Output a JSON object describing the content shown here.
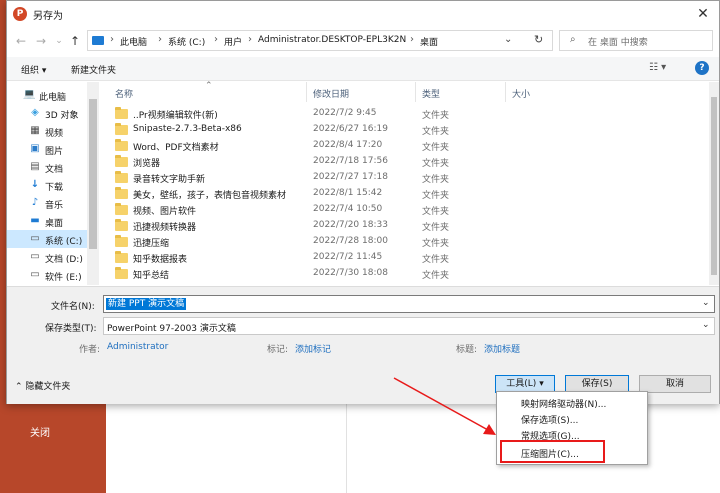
{
  "background_app": {
    "close_label": "关闭",
    "accent": "#b7472a"
  },
  "dialog": {
    "title": "另存为",
    "app_icon": "P",
    "close_glyph": "✕"
  },
  "address_bar": {
    "crumbs": [
      "此电脑",
      "系统 (C:)",
      "用户",
      "Administrator.DESKTOP-EPL3K2N",
      "桌面"
    ],
    "search_placeholder": "在 桌面 中搜索"
  },
  "toolbar": {
    "organize": "组织 ▾",
    "new_folder": "新建文件夹"
  },
  "nav_pane": {
    "items": [
      {
        "label": "此电脑",
        "icon": "computer-icon",
        "glyph": "💻"
      },
      {
        "label": "3D 对象",
        "icon": "cube-icon",
        "glyph": "◈"
      },
      {
        "label": "视频",
        "icon": "video-icon",
        "glyph": "▦"
      },
      {
        "label": "图片",
        "icon": "image-icon",
        "glyph": "▣"
      },
      {
        "label": "文档",
        "icon": "document-icon",
        "glyph": "▤"
      },
      {
        "label": "下载",
        "icon": "download-icon",
        "glyph": "↓"
      },
      {
        "label": "音乐",
        "icon": "music-icon",
        "glyph": "♪"
      },
      {
        "label": "桌面",
        "icon": "desktop-icon",
        "glyph": "▬"
      },
      {
        "label": "系统 (C:)",
        "icon": "drive-icon",
        "glyph": "▭"
      },
      {
        "label": "文档 (D:)",
        "icon": "drive-icon",
        "glyph": "▭"
      },
      {
        "label": "软件 (E:)",
        "icon": "drive-icon",
        "glyph": "▭"
      }
    ]
  },
  "file_list": {
    "columns": [
      "名称",
      "修改日期",
      "类型",
      "大小"
    ],
    "rows": [
      {
        "name": "..Pr视频编辑软件(新)",
        "date": "2022/7/2 9:45",
        "type": "文件夹"
      },
      {
        "name": "Snipaste-2.7.3-Beta-x86",
        "date": "2022/6/27 16:19",
        "type": "文件夹"
      },
      {
        "name": "Word、PDF文档素材",
        "date": "2022/8/4 17:20",
        "type": "文件夹"
      },
      {
        "name": "浏览器",
        "date": "2022/7/18 17:56",
        "type": "文件夹"
      },
      {
        "name": "录音转文字助手新",
        "date": "2022/7/27 17:18",
        "type": "文件夹"
      },
      {
        "name": "美女，壁纸，孩子，表情包音视频素材",
        "date": "2022/8/1 15:42",
        "type": "文件夹"
      },
      {
        "name": "视频、图片软件",
        "date": "2022/7/4 10:50",
        "type": "文件夹"
      },
      {
        "name": "迅捷视频转换器",
        "date": "2022/7/20 18:33",
        "type": "文件夹"
      },
      {
        "name": "迅捷压缩",
        "date": "2022/7/28 18:00",
        "type": "文件夹"
      },
      {
        "name": "知乎数据报表",
        "date": "2022/7/2 11:45",
        "type": "文件夹"
      },
      {
        "name": "知乎总结",
        "date": "2022/7/30 18:08",
        "type": "文件夹"
      }
    ]
  },
  "form": {
    "filename_label": "文件名(N):",
    "filename_value": "新建 PPT 演示文稿",
    "filetype_label": "保存类型(T):",
    "filetype_value": "PowerPoint 97-2003 演示文稿",
    "author_label": "作者:",
    "author_value": "Administrator",
    "tags_label": "标记:",
    "tags_value": "添加标记",
    "title_label": "标题:",
    "title_value": "添加标题"
  },
  "footer": {
    "hide_folders": "隐藏文件夹",
    "tools": "工具(L)",
    "save": "保存(S)",
    "cancel": "取消"
  },
  "tools_menu": {
    "items": [
      "映射网络驱动器(N)...",
      "保存选项(S)...",
      "常规选项(G)...",
      "压缩图片(C)..."
    ],
    "highlighted": "压缩图片(C)..."
  },
  "colors": {
    "highlight_red": "#e81a1a",
    "selection_blue": "#0078d7",
    "folder_yellow": "#f6d26a"
  }
}
